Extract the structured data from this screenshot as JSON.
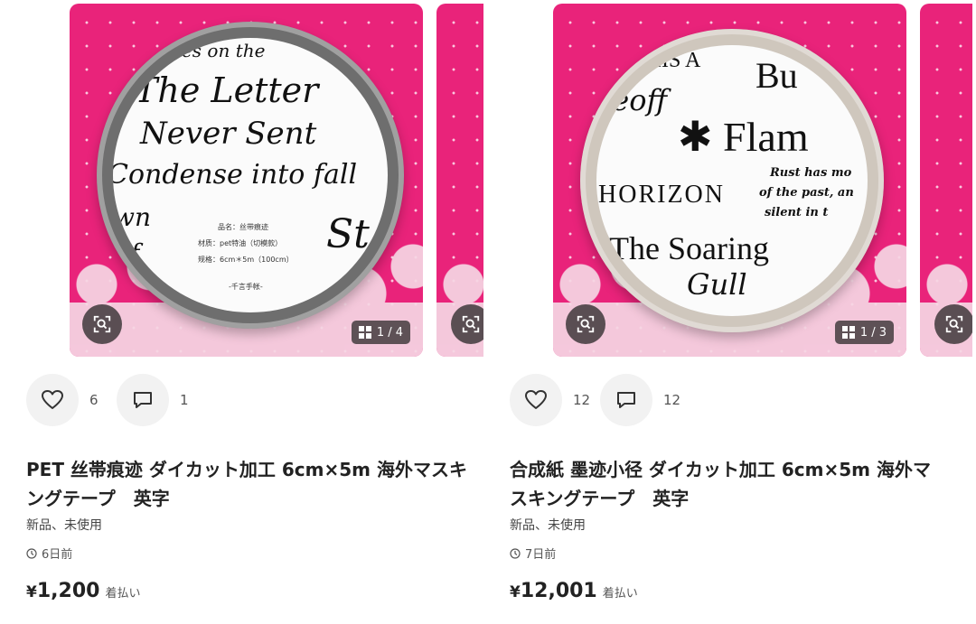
{
  "products": [
    {
      "image_counter": "1 / 4",
      "likes": "6",
      "comments": "1",
      "title": "PET 丝帯痕迹 ダイカット加工 6cm×5m 海外マスキングテープ　英字",
      "condition": "新品、未使用",
      "posted": "6日前",
      "price_symbol": "¥",
      "price": "1,200",
      "shipping": "着払い",
      "image_text": {
        "l1": "ries on the",
        "l2": "The Letter",
        "l3": "Never Sent",
        "l4": "Condense into fall",
        "l5": "wn",
        "l6": "of",
        "l7": "St",
        "info1": "品名：丝带痕迹",
        "info2": "材质：pet特油（切模款）",
        "info3": "规格：6cm＊5m（100cm）",
        "brand": "-千言手帐-"
      }
    },
    {
      "image_counter": "1 / 3",
      "likes": "12",
      "comments": "12",
      "title": "合成紙 墨迹小径 ダイカット加工 6cm×5m 海外マスキングテープ　英字",
      "condition": "新品、未使用",
      "posted": "7日前",
      "price_symbol": "¥",
      "price": "12,001",
      "shipping": "着払い",
      "image_text": {
        "l1": "THIS A",
        "l2": "Bu",
        "l3": "reoff",
        "l4": "✱ Flam",
        "l5": "Rust has mo",
        "l6": "of the past, an",
        "l7": "silent in t",
        "l8": "HORIZON",
        "l9": "The Soaring",
        "l10": "Gull"
      }
    }
  ]
}
